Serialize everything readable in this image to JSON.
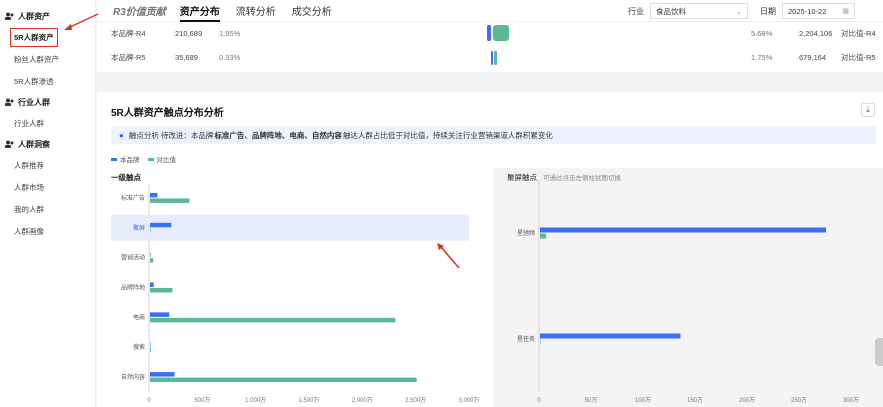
{
  "colors": {
    "brand_blue": "#3b6ff5",
    "compare_green": "#5ab893",
    "highlight": "#e6ecfc",
    "annotation_red": "#e0301e"
  },
  "sidebar": {
    "groups": [
      {
        "label": "人群资产",
        "icon": "people-icon",
        "items": [
          {
            "label": "5R人群资产",
            "active": true
          },
          {
            "label": "粉丝人群资产"
          },
          {
            "label": "5R人群渗透"
          }
        ]
      },
      {
        "label": "行业人群",
        "icon": "people-icon",
        "items": [
          {
            "label": "行业人群"
          }
        ]
      },
      {
        "label": "人群洞察",
        "icon": "people-icon",
        "items": [
          {
            "label": "人群推荐"
          },
          {
            "label": "人群市场"
          },
          {
            "label": "我的人群"
          },
          {
            "label": "人群画像"
          }
        ]
      }
    ]
  },
  "topbar": {
    "brand": "R3价值贡献",
    "tabs": [
      {
        "label": "资产分布",
        "active": true
      },
      {
        "label": "流转分析"
      },
      {
        "label": "成交分析"
      }
    ],
    "industry_label": "行业",
    "industry_value": "食品饮料",
    "date_label": "日期",
    "date_value": "2025-10-22"
  },
  "rows": [
    {
      "name": "本品牌-R4",
      "value": "210,689",
      "pct": "1.95%",
      "right_pct": "5.68%",
      "right_value": "2,204,106",
      "right_name": "对比值-R4"
    },
    {
      "name": "本品牌-R5",
      "value": "35,689",
      "pct": "0.33%",
      "right_pct": "1.75%",
      "right_value": "679,164",
      "right_name": "对比值-R5"
    }
  ],
  "panel": {
    "title": "5R人群资产触点分布分析",
    "notice_prefix": "触点分析 待改进：本品牌",
    "notice_bold": "标准广告、品牌阵地、电商、自然内容",
    "notice_suffix": "触达人群占比低于对比值，持续关注行业营销渠道人群积累变化",
    "legend_brand": "本品牌",
    "legend_compare": "对比值",
    "left_title": "一级触点",
    "right_title": "聚屏触点",
    "right_hint": "可通过点击左侧柱状图切换"
  },
  "chart_data": [
    {
      "type": "bar",
      "orientation": "horizontal",
      "title": "一级触点",
      "categories": [
        "标准广告",
        "聚屏",
        "营销活动",
        "品牌阵地",
        "电商",
        "搜索",
        "自然内容"
      ],
      "series": [
        {
          "name": "本品牌",
          "values": [
            70,
            200,
            5,
            35,
            180,
            2,
            230
          ]
        },
        {
          "name": "对比值",
          "values": [
            370,
            0,
            30,
            210,
            2300,
            8,
            2500
          ]
        }
      ],
      "unit": "万",
      "xlim": [
        0,
        3000
      ],
      "ticks": [
        "0",
        "500万",
        "1,000万",
        "1,500万",
        "2,000万",
        "2,500万",
        "3,000万"
      ],
      "highlighted_category": "聚屏",
      "grid": false
    },
    {
      "type": "bar",
      "orientation": "horizontal",
      "title": "聚屏触点",
      "categories": [
        "星驰频",
        "星任务"
      ],
      "series": [
        {
          "name": "本品牌",
          "values": [
            275,
            135
          ]
        },
        {
          "name": "对比值",
          "values": [
            6,
            0
          ]
        }
      ],
      "unit": "万",
      "xlim": [
        0,
        300
      ],
      "ticks": [
        "0",
        "50万",
        "100万",
        "150万",
        "200万",
        "250万",
        "300万"
      ],
      "grid": false
    }
  ]
}
